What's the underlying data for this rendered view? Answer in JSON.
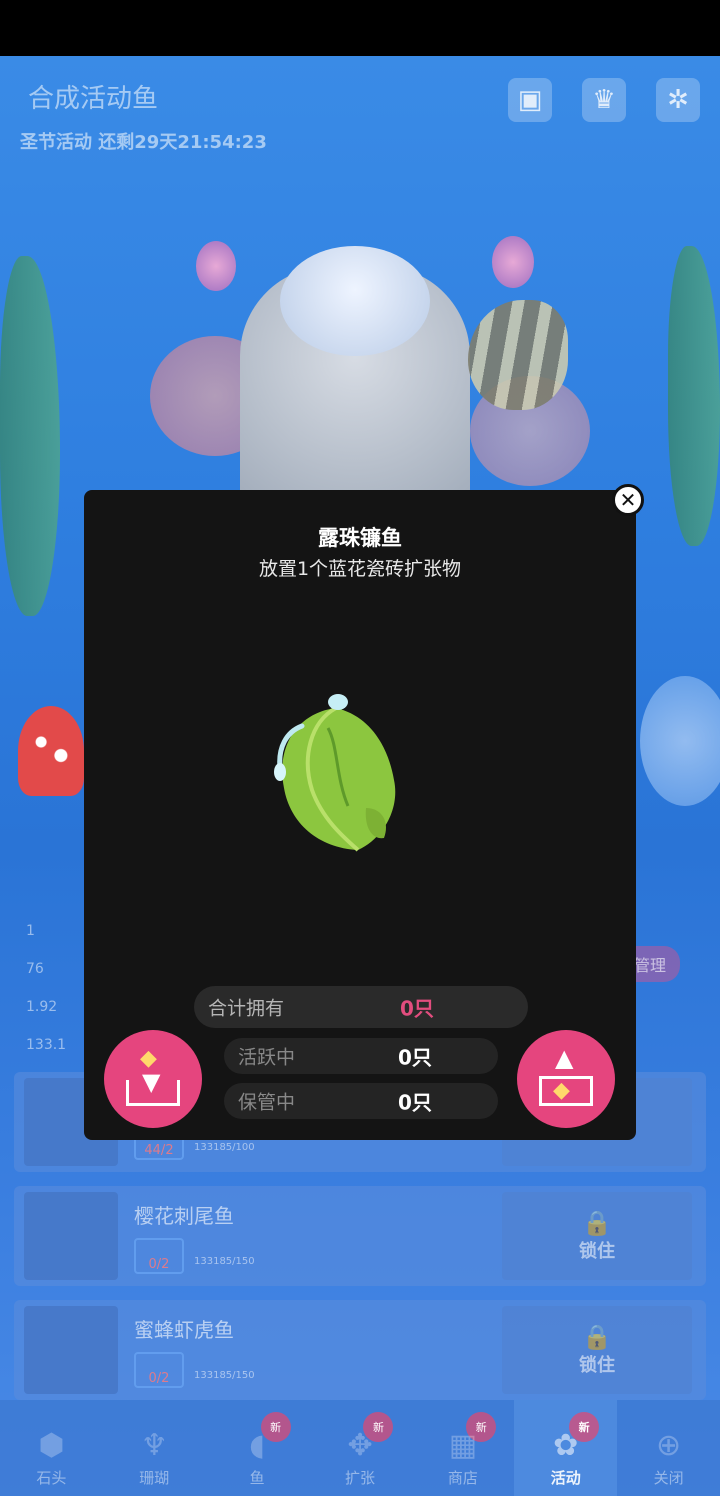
{
  "game": {
    "tank_title": "合成活动鱼",
    "event_status": "圣节活动 还剩29天21:54:23",
    "top_icons": [
      "gallery-icon",
      "trophy-icon",
      "gear-icon"
    ]
  },
  "background_stats": {
    "line1": "1",
    "line2": "76",
    "line3": "1.92",
    "line4": "133.1",
    "manage_label": "管理"
  },
  "background_list": [
    {
      "name": "",
      "count": "44/2",
      "small": "133185/100",
      "lock": ""
    },
    {
      "name": "樱花刺尾鱼",
      "count": "0/2",
      "small": "133185/150",
      "lock": "锁住"
    },
    {
      "name": "蜜蜂虾虎鱼",
      "count": "0/2",
      "small": "133185/150",
      "lock": "锁住"
    }
  ],
  "bottom_nav": [
    {
      "label": "石头",
      "icon": "stone-icon",
      "new": ""
    },
    {
      "label": "珊瑚",
      "icon": "coral-icon",
      "new": ""
    },
    {
      "label": "鱼",
      "icon": "fish-icon",
      "new": "新"
    },
    {
      "label": "扩张",
      "icon": "expand-icon",
      "new": "新"
    },
    {
      "label": "商店",
      "icon": "shop-icon",
      "new": "新"
    },
    {
      "label": "活动",
      "icon": "event-icon",
      "new": "新"
    },
    {
      "label": "关闭",
      "icon": "close-down-icon",
      "new": ""
    }
  ],
  "modal": {
    "title": "露珠镰鱼",
    "subtitle": "放置1个蓝花瓷砖扩张物",
    "total_label": "合计拥有",
    "total_value": "0只",
    "active_label": "活跃中",
    "active_value": "0只",
    "stored_label": "保管中",
    "stored_value": "0只",
    "store_button_icon": "store-fish-icon",
    "release_button_icon": "release-fish-icon",
    "close_icon": "close-icon"
  },
  "colors": {
    "accent_pink": "#e5457e",
    "modal_bg": "#141414",
    "value_pink": "#e24d7e"
  }
}
